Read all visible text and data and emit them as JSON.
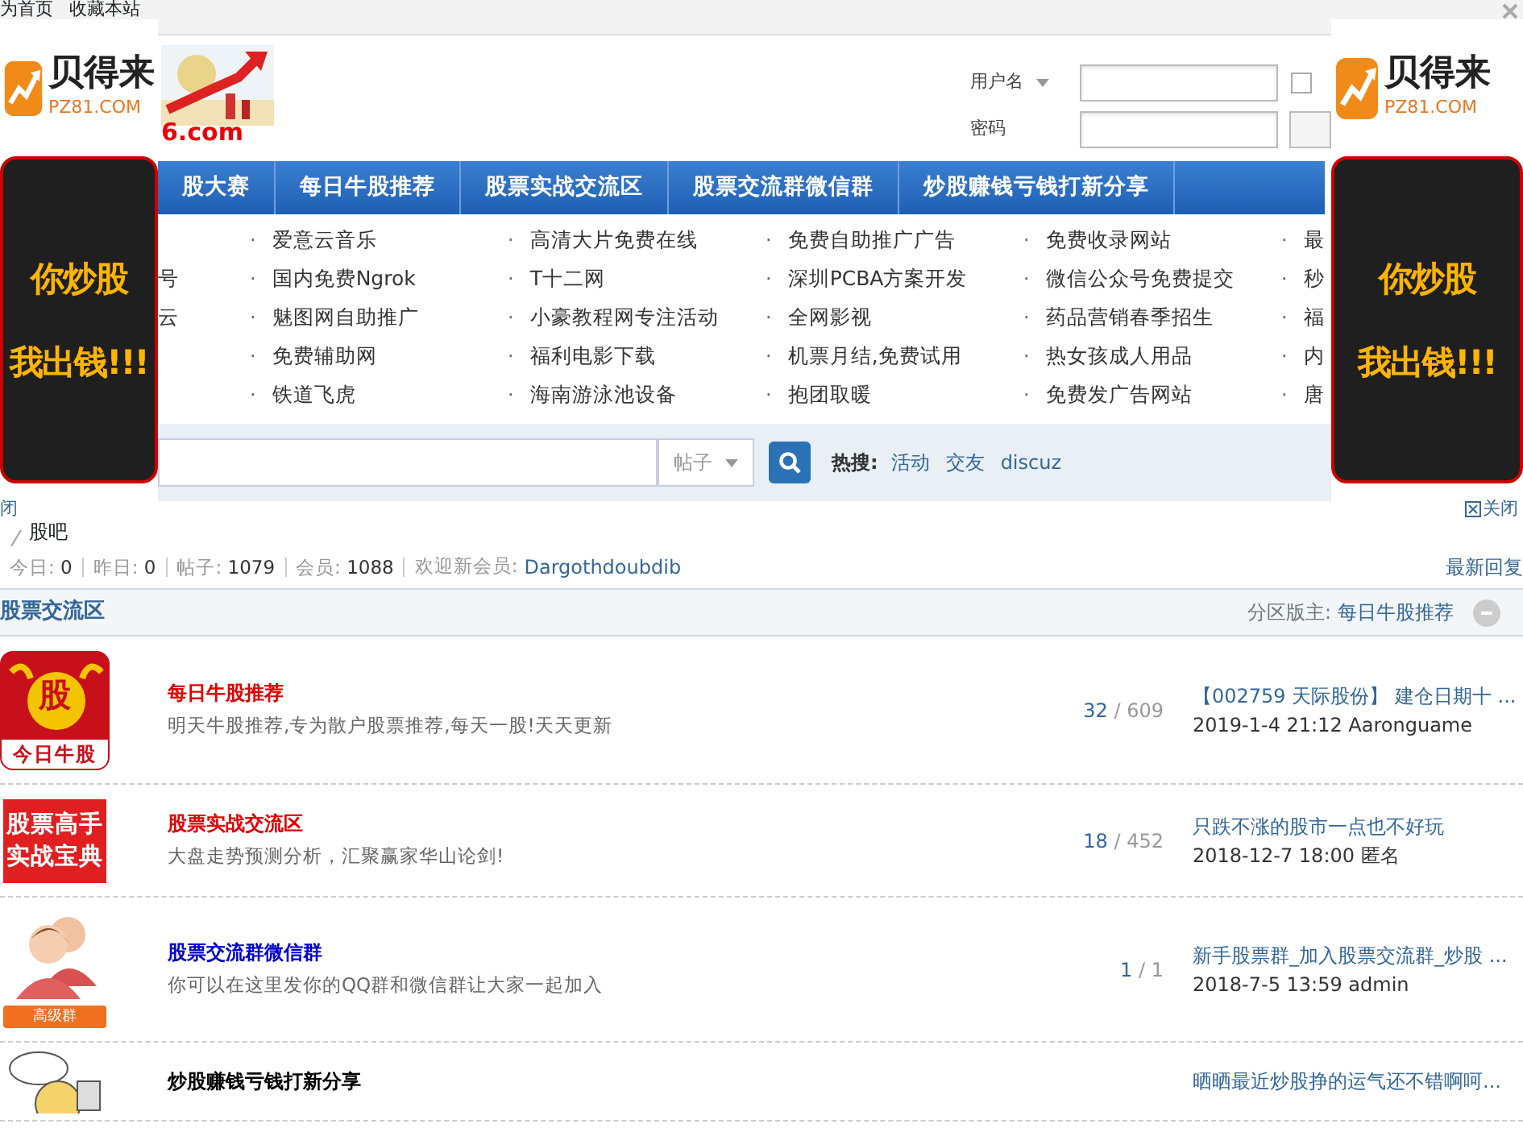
{
  "top_bar": {
    "links": [
      "为首页",
      "收藏本站"
    ]
  },
  "ads": [
    {
      "brand": "贝得来",
      "domain": "PZ81.COM",
      "slogan": [
        "你炒股",
        "我出钱!!!"
      ],
      "close": "闭"
    },
    {
      "brand": "贝得来",
      "domain": "PZ81.COM",
      "slogan": [
        "你炒股",
        "我出钱!!!"
      ],
      "close": "关闭"
    }
  ],
  "site_logo": {
    "text": "6.com"
  },
  "login": {
    "username_label": "用户名",
    "password_label": "密码",
    "remember_checked": false
  },
  "nav": {
    "items": [
      "股大赛",
      "每日牛股推荐",
      "股票实战交流区",
      "股票交流群微信群",
      "炒股赚钱亏钱打新分享"
    ]
  },
  "link_fragments": [
    "号",
    "云"
  ],
  "link_columns": [
    {
      "bullet": "·",
      "items": [
        "爱意云音乐",
        "国内免费Ngrok",
        "魅图网自助推广",
        "免费辅助网",
        "铁道飞虎"
      ]
    },
    {
      "bullet": "·",
      "items": [
        "高清大片免费在线",
        "T十二网",
        "小豪教程网专注活动",
        "福利电影下载",
        "海南游泳池设备"
      ]
    },
    {
      "bullet": "·",
      "items": [
        "免费自助推广广告",
        "深圳PCBA方案开发",
        "全网影视",
        "机票月结,免费试用",
        "抱团取暖"
      ]
    },
    {
      "bullet": "·",
      "items": [
        "免费收录网站",
        "微信公众号免费提交",
        "药品营销春季招生",
        "热女孩成人用品",
        "免费发广告网站"
      ]
    },
    {
      "bullet": "·",
      "items": [
        "最",
        "秒",
        "福",
        "内",
        "唐"
      ]
    }
  ],
  "search": {
    "scope": "帖子",
    "hot_label": "热搜:",
    "hot_links": [
      "活动",
      "交友",
      "discuz"
    ]
  },
  "breadcrumb": "股吧",
  "stats": [
    {
      "label": "今日:",
      "value": "0"
    },
    {
      "label": "昨日:",
      "value": "0"
    },
    {
      "label": "帖子:",
      "value": "1079"
    },
    {
      "label": "会员:",
      "value": "1088"
    }
  ],
  "new_member": {
    "label": "欢迎新会员:",
    "name": "Dargothdoubdib"
  },
  "latest_reply": "最新回复",
  "category": {
    "title": "股票交流区",
    "moderator_label": "分区版主:",
    "moderator": "每日牛股推荐",
    "expanded": true
  },
  "forums": [
    {
      "icon": {
        "kind": "bull",
        "texts": [
          "股",
          "今日牛股"
        ]
      },
      "title": "每日牛股推荐",
      "color": "#e00000",
      "description": "明天牛股推荐,专为散户股票推荐,每天一股!天天更新",
      "threads": "32",
      "posts": "/ 609",
      "last_title": "【002759 天际股份】 建仓日期十 ...",
      "last_meta": "2019-1-4 21:12 Aaronguame"
    },
    {
      "icon": {
        "kind": "book",
        "texts": [
          "股票高手",
          "实战宝典"
        ]
      },
      "title": "股票实战交流区",
      "color": "#e00000",
      "description": "大盘走势预测分析，汇聚赢家华山论剑!",
      "threads": "18",
      "posts": "/ 452",
      "last_title": "只跌不涨的股市一点也不好玩",
      "last_meta": "2018-12-7 18:00 匿名"
    },
    {
      "icon": {
        "kind": "people",
        "texts": [
          "高级群"
        ]
      },
      "title": "股票交流群微信群",
      "color": "#0000cc",
      "description": "你可以在这里发你的QQ群和微信群让大家一起加入",
      "threads": "1",
      "posts": "/ 1",
      "last_title": "新手股票群_加入股票交流群_炒股 ...",
      "last_meta": "2018-7-5 13:59 admin"
    },
    {
      "icon": {
        "kind": "cartoon"
      },
      "title": "炒股赚钱亏钱打新分享",
      "color": "#000000",
      "last_title": "晒晒最近炒股挣的运气还不错啊呵..."
    }
  ]
}
